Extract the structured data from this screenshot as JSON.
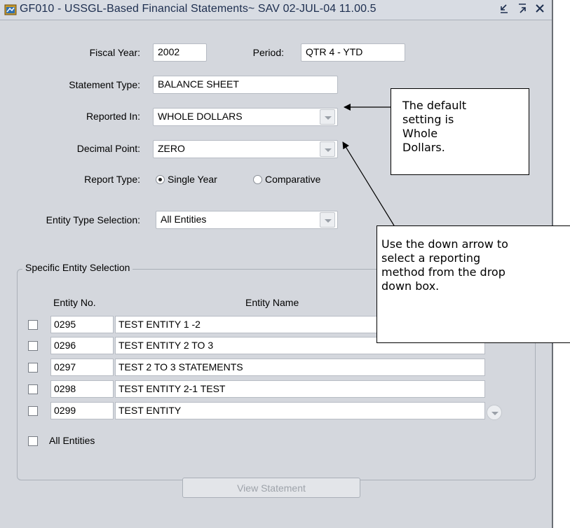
{
  "window": {
    "title": "GF010 - USSGL-Based Financial Statements~ SAV  02-JUL-04 11.00.5",
    "controls": [
      "minimize-icon",
      "maximize-icon",
      "close-icon"
    ]
  },
  "form": {
    "fiscal_year_label": "Fiscal Year:",
    "fiscal_year_value": "2002",
    "period_label": "Period:",
    "period_value": "QTR 4 - YTD",
    "statement_type_label": "Statement Type:",
    "statement_type_value": "BALANCE SHEET",
    "reported_in_label": "Reported In:",
    "reported_in_value": "WHOLE DOLLARS",
    "decimal_point_label": "Decimal Point:",
    "decimal_point_value": "ZERO",
    "report_type_label": "Report Type:",
    "report_type_options": [
      "Single Year",
      "Comparative"
    ],
    "report_type_selected": "Single Year",
    "entity_type_label": "Entity Type Selection:",
    "entity_type_value": "All Entities"
  },
  "entity_group": {
    "title": "Specific Entity Selection",
    "col_no": "Entity No.",
    "col_name": "Entity Name",
    "rows": [
      {
        "no": "0295",
        "name": "TEST ENTITY 1 -2"
      },
      {
        "no": "0296",
        "name": "TEST ENTITY 2 TO 3"
      },
      {
        "no": "0297",
        "name": "TEST 2 TO 3 STATEMENTS"
      },
      {
        "no": "0298",
        "name": "TEST ENTITY 2-1 TEST"
      },
      {
        "no": "0299",
        "name": "TEST ENTITY"
      }
    ],
    "all_entities_label": "All Entities"
  },
  "view_button": "View Statement",
  "callouts": {
    "default_setting": "The default\nsetting is\nWhole\nDollars.",
    "down_arrow": "Use the down arrow to\nselect a reporting\nmethod from the drop\ndown box."
  }
}
